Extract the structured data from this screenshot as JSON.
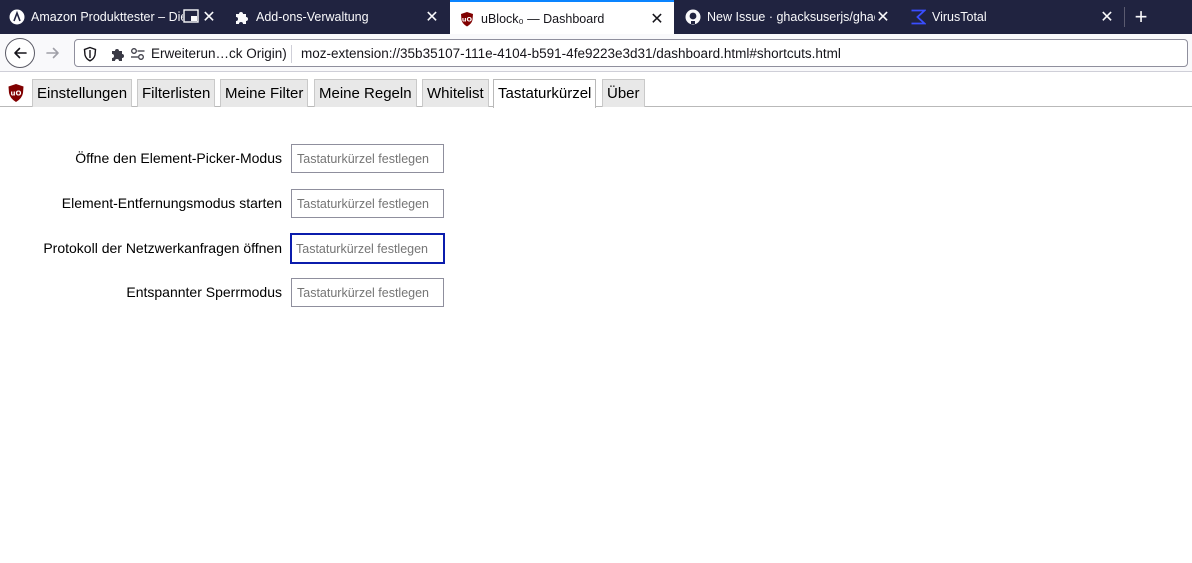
{
  "browser": {
    "tabs": [
      {
        "title": "Amazon Produkttester – Die",
        "favicon": "amazon-tester-icon",
        "active": false
      },
      {
        "title": "Add-ons-Verwaltung",
        "favicon": "puzzle-icon",
        "active": false
      },
      {
        "title": "uBlock₀ — Dashboard",
        "favicon": "ublock-icon",
        "active": true
      },
      {
        "title": "New Issue · ghacksuserjs/ghack",
        "favicon": "github-icon",
        "active": false
      },
      {
        "title": "VirusTotal",
        "favicon": "virustotal-icon",
        "active": false
      }
    ],
    "close_glyph": "✕",
    "new_tab_glyph": "+",
    "identity_label": "Erweiterun…ck Origin)",
    "url": "moz-extension://35b35107-111e-4104-b591-4fe9223e3d31/dashboard.html#shortcuts.html"
  },
  "dashboard": {
    "tabs": [
      {
        "label": "Einstellungen",
        "active": false
      },
      {
        "label": "Filterlisten",
        "active": false
      },
      {
        "label": "Meine Filter",
        "active": false
      },
      {
        "label": "Meine Regeln",
        "active": false
      },
      {
        "label": "Whitelist",
        "active": false
      },
      {
        "label": "Tastaturkürzel",
        "active": true
      },
      {
        "label": "Über",
        "active": false
      }
    ]
  },
  "shortcuts": [
    {
      "label": "Öffne den Element-Picker-Modus",
      "placeholder": "Tastaturkürzel festlegen",
      "value": ""
    },
    {
      "label": "Element-Entfernungsmodus starten",
      "placeholder": "Tastaturkürzel festlegen",
      "value": ""
    },
    {
      "label": "Protokoll der Netzwerkanfragen öffnen",
      "placeholder": "Tastaturkürzel festlegen",
      "value": "",
      "focused": true
    },
    {
      "label": "Entspannter Sperrmodus",
      "placeholder": "Tastaturkürzel festlegen",
      "value": ""
    }
  ],
  "colors": {
    "tabstrip_bg": "#202340",
    "active_tab_accent": "#0a84ff",
    "ublock_red": "#800000",
    "focus_border": "#0b1cac",
    "virustotal_blue": "#394eff"
  }
}
